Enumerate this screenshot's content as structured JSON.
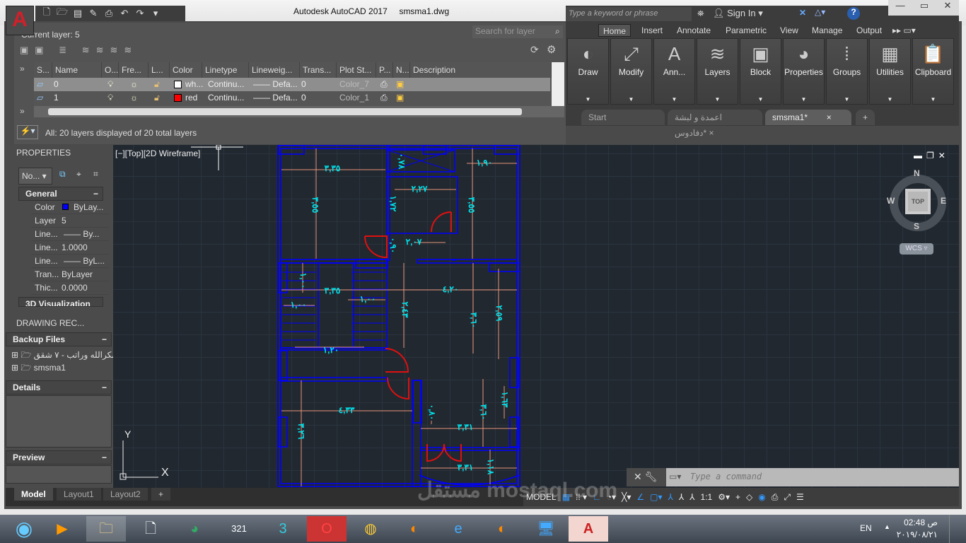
{
  "window": {
    "app_title": "Autodesk AutoCAD 2017",
    "file": "smsma1.dwg",
    "logo": "A"
  },
  "qat": {
    "icons": [
      "new-icon",
      "open-icon",
      "save-icon",
      "save-as-icon",
      "plot-icon",
      "undo-icon",
      "redo-icon",
      "customize-icon"
    ]
  },
  "search": {
    "keyword_placeholder": "Type a keyword or phrase",
    "sign_in": "Sign In"
  },
  "ribbon": {
    "tabs": [
      "Home",
      "Insert",
      "Annotate",
      "Parametric",
      "View",
      "Manage",
      "Output"
    ],
    "active_tab": "Home",
    "panels": [
      {
        "label": "Draw",
        "icon": "◐"
      },
      {
        "label": "Modify",
        "icon": "⤢"
      },
      {
        "label": "Ann...",
        "icon": "A"
      },
      {
        "label": "Layers",
        "icon": "≋"
      },
      {
        "label": "Block",
        "icon": "▣"
      },
      {
        "label": "Properties",
        "icon": "◕"
      },
      {
        "label": "Groups",
        "icon": "⁞"
      },
      {
        "label": "Utilities",
        "icon": "▦"
      },
      {
        "label": "Clipboard",
        "icon": "📋"
      }
    ]
  },
  "file_tabs": [
    {
      "label": "Start"
    },
    {
      "label": "اعمدة و لبشة دفادوس*"
    },
    {
      "label": "smsma1*"
    }
  ],
  "layers": {
    "current": "Current layer: 5",
    "search_placeholder": "Search for layer",
    "columns": [
      "S...",
      "Name",
      "O...",
      "Fre...",
      "L...",
      "Color",
      "Linetype",
      "Lineweig...",
      "Trans...",
      "Plot St...",
      "P...",
      "N...",
      "Description"
    ],
    "rows": [
      {
        "name": "0",
        "color_name": "wh...",
        "color": "#ffffff",
        "linetype": "Continu...",
        "lineweight": "Defa...",
        "transparency": "0",
        "plot_style": "Color_7"
      },
      {
        "name": "1",
        "color_name": "red",
        "color": "#ff0000",
        "linetype": "Continu...",
        "lineweight": "Defa...",
        "transparency": "0",
        "plot_style": "Color_1"
      }
    ],
    "filter_status": "All: 20 layers displayed of 20 total layers"
  },
  "properties": {
    "title": "PROPERTIES",
    "selector": "No...",
    "general": "General",
    "rows": [
      {
        "label": "Color",
        "value": "ByLay...",
        "swatch": "#0000ff"
      },
      {
        "label": "Layer",
        "value": "5"
      },
      {
        "label": "Line...",
        "value": "—— By..."
      },
      {
        "label": "Line...",
        "value": "1.0000"
      },
      {
        "label": "Line...",
        "value": "—— ByL..."
      },
      {
        "label": "Tran...",
        "value": "ByLayer"
      },
      {
        "label": "Thic...",
        "value": "0.0000"
      }
    ],
    "viz": "3D Visualization"
  },
  "recovery": {
    "title": "DRAWING REC...",
    "backup": "Backup Files",
    "files": [
      "شكرالله وراتب - ٧ شقق",
      "smsma1"
    ],
    "details": "Details",
    "preview": "Preview"
  },
  "viewport": {
    "label": "[−][Top][2D Wireframe]",
    "cube": {
      "top": "TOP",
      "n": "N",
      "s": "S",
      "e": "E",
      "w": "W",
      "wcs": "WCS"
    },
    "ucs": {
      "x": "X",
      "y": "Y"
    }
  },
  "plan": {
    "dims": [
      "٣,٣٥",
      "٣,٥٥",
      "٠,٧٨",
      "١,٩٠",
      "٢,٢٧",
      "١,٧٢",
      "٣,٥٥",
      "٢,٠٧",
      "٠,٩٠",
      "١,٠٠",
      "٣,٣٥",
      "٤,٢٠",
      "١,٠٠",
      "١,٠٠",
      "٢,٤٣",
      "٣,٦٠",
      "٢,٥٩",
      "١,٢٠",
      "٤,٣٣",
      "٠,٨٠",
      "٣,٦٠",
      "١,٦٣",
      "٣,٣١",
      "٣,٢٦",
      "٣,٣١",
      "١,١٨"
    ],
    "wall_color": "#0000ff",
    "dim_color": "#e8957a",
    "text_color": "#00e5ee",
    "door_color": "#e01010"
  },
  "layout_tabs": [
    "Model",
    "Layout1",
    "Layout2",
    "+"
  ],
  "command": {
    "placeholder": "Type a command"
  },
  "status": {
    "model": "MODEL",
    "scale": "1:1"
  },
  "taskbar": {
    "lang": "EN",
    "time": "02:48 ص",
    "date": "٢٠١٩/٠٨/٢١",
    "watermark": "مستقل mostaql.com"
  }
}
